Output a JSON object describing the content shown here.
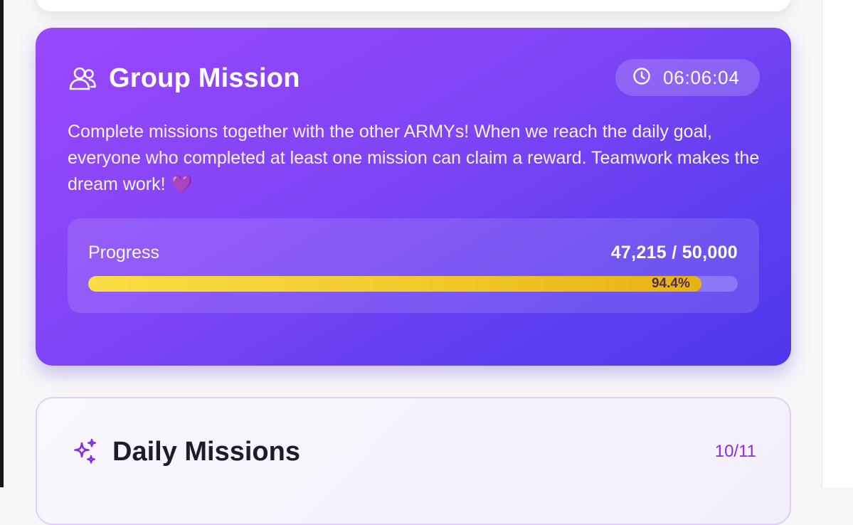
{
  "colors": {
    "card_gradient_start": "#9a47fb",
    "card_gradient_end": "#4e38ec",
    "progress_fill": "#f1c92b",
    "daily_accent": "#8a2be2"
  },
  "group_mission": {
    "icon": "users-icon",
    "title": "Group Mission",
    "timer_icon": "clock-icon",
    "timer": "06:06:04",
    "description": "Complete missions together with the other ARMYs! When we reach the daily goal, everyone who completed at least one mission can claim a reward. Teamwork makes the dream work! 💜",
    "progress": {
      "label": "Progress",
      "count": "47,215 / 50,000",
      "percent_label": "94.4%",
      "fraction": 0.944
    }
  },
  "daily_missions": {
    "icon": "sparkles-icon",
    "title": "Daily Missions",
    "count": "10/11"
  }
}
